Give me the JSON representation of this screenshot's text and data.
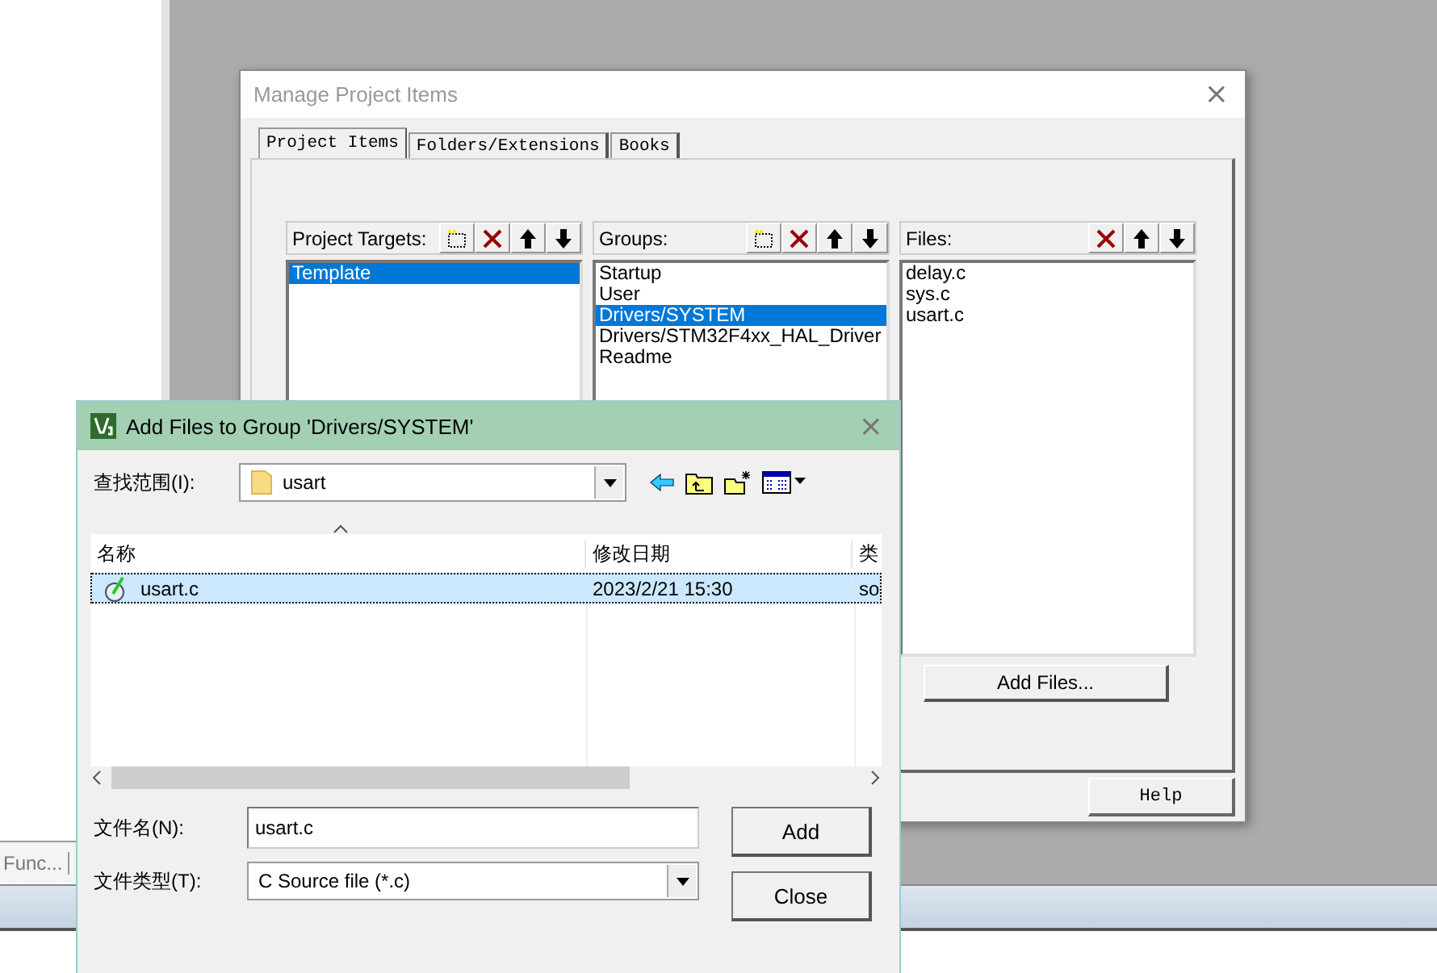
{
  "background": {
    "panel_tab": "Func..."
  },
  "manage_dialog": {
    "title": "Manage Project Items",
    "close": "×",
    "tabs": [
      {
        "label": "Project Items",
        "selected": true
      },
      {
        "label": "Folders/Extensions",
        "selected": false
      },
      {
        "label": "Books",
        "selected": false
      }
    ],
    "lists": [
      {
        "label": "Project Targets:",
        "new_button": true,
        "items": [
          {
            "label": "Template",
            "selected": true
          }
        ]
      },
      {
        "label": "Groups:",
        "new_button": true,
        "items": [
          {
            "label": "Startup",
            "selected": false
          },
          {
            "label": "User",
            "selected": false
          },
          {
            "label": "Drivers/SYSTEM",
            "selected": true
          },
          {
            "label": "Drivers/STM32F4xx_HAL_Driver",
            "selected": false
          },
          {
            "label": "Readme",
            "selected": false
          }
        ]
      },
      {
        "label": "Files:",
        "new_button": false,
        "items": [
          {
            "label": "delay.c",
            "selected": false
          },
          {
            "label": "sys.c",
            "selected": false
          },
          {
            "label": "usart.c",
            "selected": false
          }
        ]
      }
    ],
    "add_files_button": "Add Files...",
    "help_button": "Help"
  },
  "add_dialog": {
    "title": "Add Files to Group 'Drivers/SYSTEM'",
    "close": "×",
    "look_in_label": "查找范围(I):",
    "look_in_value": "usart",
    "columns": [
      "名称",
      "修改日期",
      "类"
    ],
    "rows": [
      {
        "name": "usart.c",
        "modified": "2023/2/21 15:30",
        "column_3": "so",
        "selected": true
      }
    ],
    "file_name_label": "文件名(N):",
    "file_name": "usart.c",
    "file_type_label": "文件类型(T):",
    "file_type": "C Source file (*.c)",
    "buttons": [
      "Add",
      "Close"
    ]
  }
}
